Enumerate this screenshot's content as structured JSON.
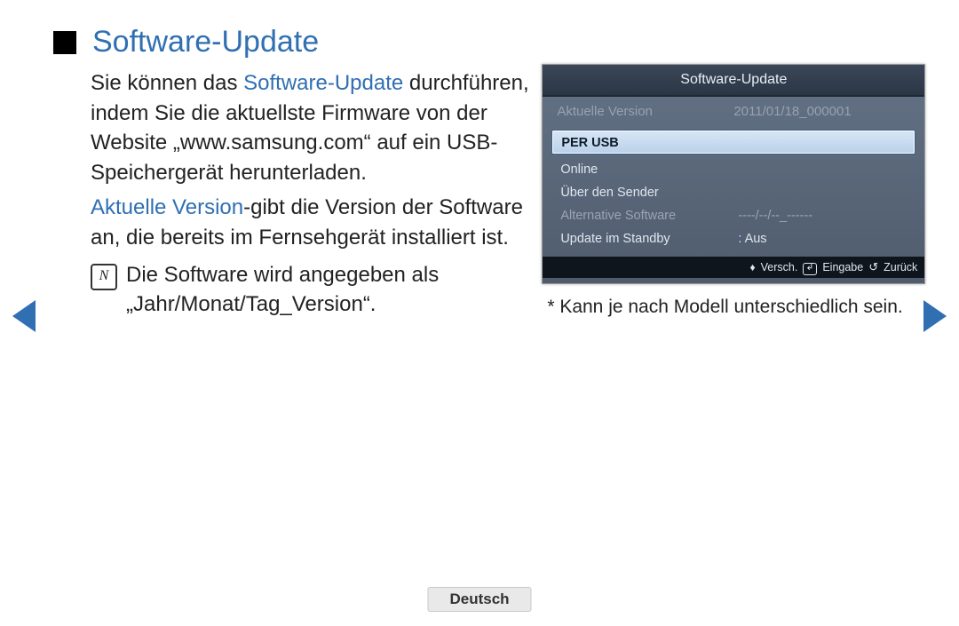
{
  "title": "Software-Update",
  "body": {
    "p1_prefix": "Sie können das ",
    "p1_blue": "Software-Update",
    "p1_rest": " durchführen, indem Sie die aktuellste Firmware von der Website „www.samsung.com“ auf ein USB-Speichergerät herunterladen.",
    "p2_blue": "Aktuelle Version",
    "p2_rest": "-gibt die Version der Software an, die bereits im Fernsehgerät installiert ist.",
    "note": "Die Software wird angegeben als „Jahr/Monat/Tag_Version“."
  },
  "panel": {
    "title": "Software-Update",
    "current_label": "Aktuelle Version",
    "current_value": "2011/01/18_000001",
    "options": {
      "per_usb": "PER USB",
      "online": "Online",
      "uber_sender": "Über den Sender",
      "alt_soft_label": "Alternative Software",
      "alt_soft_value": "----/--/--_------",
      "standby_label": "Update im Standby",
      "standby_value": ": Aus"
    },
    "footer": {
      "move": "Versch.",
      "enter": "Eingabe",
      "back": "Zurück"
    }
  },
  "footnote": "* Kann je nach Modell unterschiedlich sein.",
  "note_icon": "N",
  "language": "Deutsch",
  "move_arrows": "♦"
}
